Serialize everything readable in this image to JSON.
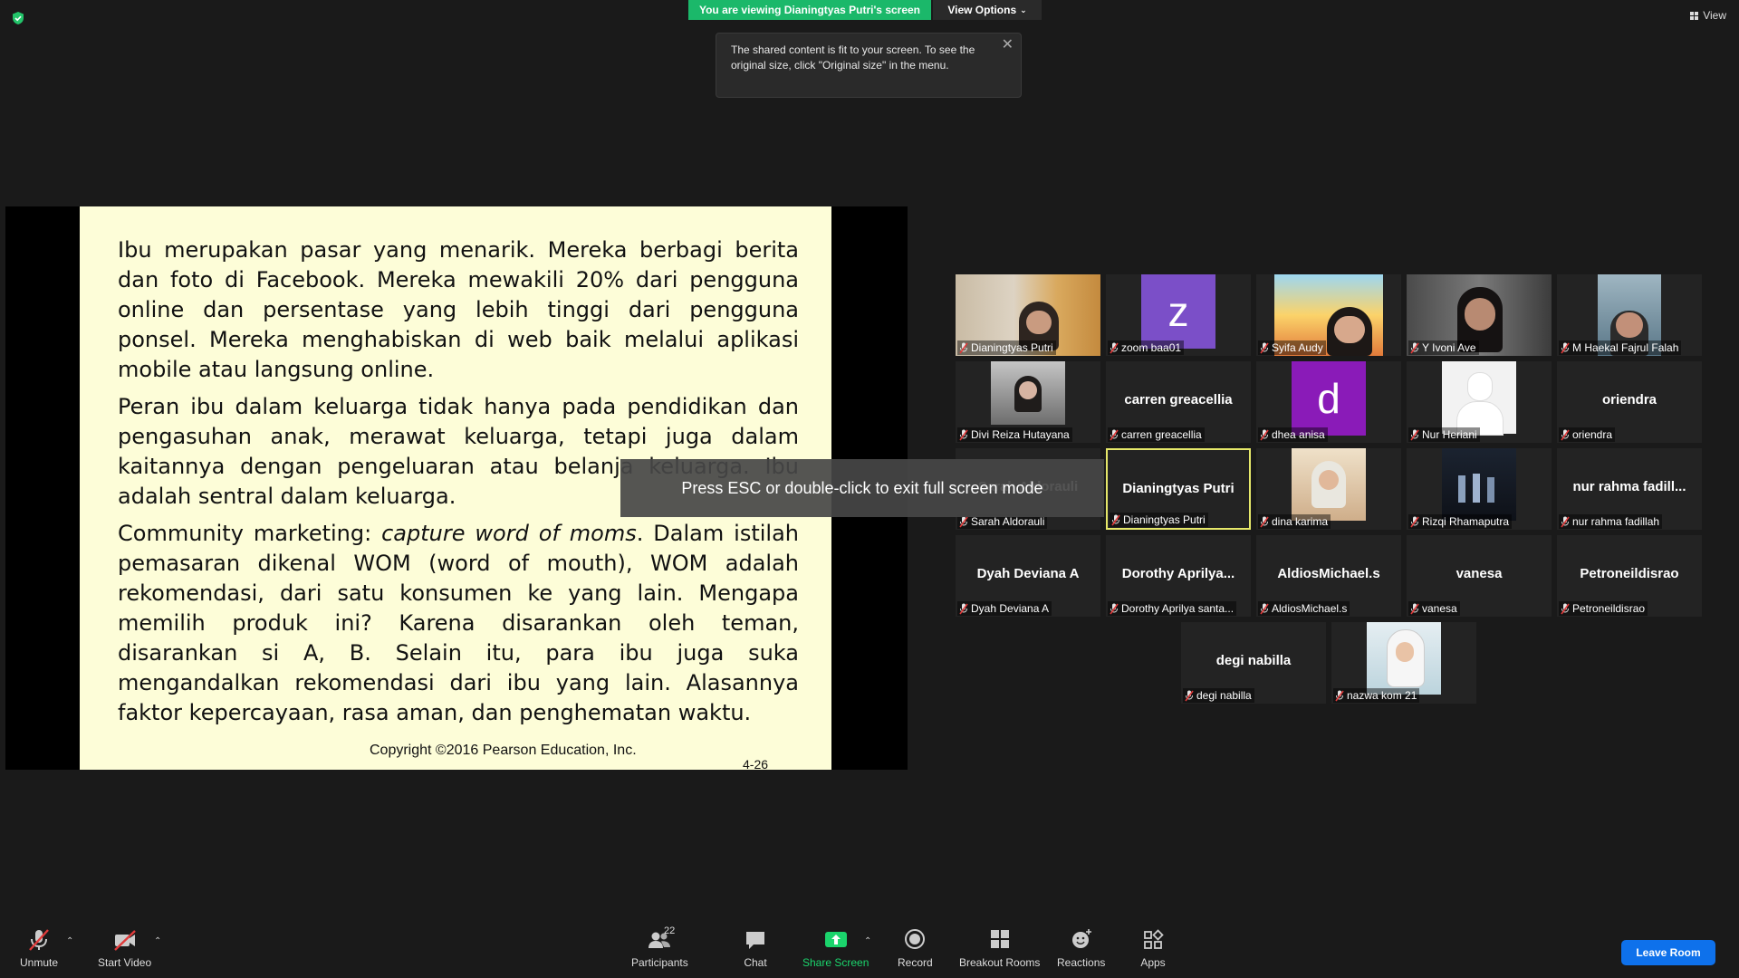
{
  "top": {
    "banner": "You are viewing Dianingtyas Putri's screen",
    "view_options": "View Options",
    "tooltip": "The shared content is fit to your screen. To see the original size, click \"Original size\" in the menu.",
    "view": "View"
  },
  "slide": {
    "p1": "Ibu merupakan pasar yang menarik. Mereka berbagi berita dan foto di Facebook. Mereka mewakili 20% dari pengguna online dan persentase yang lebih tinggi dari pengguna ponsel. Mereka menghabiskan di web baik melalui aplikasi mobile atau langsung online.",
    "p2": "Peran ibu dalam keluarga tidak hanya pada pendidikan dan pengasuhan anak, merawat keluarga, tetapi juga dalam kaitannya dengan pengeluaran atau belanja keluarga. Ibu adalah sentral dalam keluarga.",
    "p3_start": "Community marketing: ",
    "p3_italic": "capture word of moms",
    "p3_rest": ". Dalam istilah pemasaran dikenal WOM (word of mouth), WOM adalah rekomendasi, dari satu konsumen ke yang lain. Mengapa memilih produk ini? Karena disarankan oleh teman, disarankan si A, B. Selain itu, para ibu juga suka mengandalkan rekomendasi dari ibu yang lain. Alasannya faktor kepercayaan, rasa aman, dan penghematan waktu.",
    "copyright": "Copyright ©2016 Pearson Education, Inc.",
    "page": "4-26"
  },
  "overlay": {
    "esc_text": "Press ESC or double-click to exit full screen mode"
  },
  "participants": [
    {
      "label": "Dianingtyas Putri"
    },
    {
      "label": "zoom baa01",
      "avatar": "z",
      "avatar_color": "#7b4fc8"
    },
    {
      "label": "Syifa Audy"
    },
    {
      "label": "Y Ivoni Ave"
    },
    {
      "label": "M Haekal Fajrul Falah"
    },
    {
      "label": "Divi Reiza Hutayana"
    },
    {
      "label": "carren greacellia",
      "center": "carren greacellia"
    },
    {
      "label": "dhea anisa",
      "avatar": "d",
      "avatar_color": "#8a1bb8"
    },
    {
      "label": "Nur Heriani"
    },
    {
      "label": "oriendra",
      "center": "oriendra"
    },
    {
      "label": "Sarah Aldorauli",
      "center": "Sarah Aldorauli"
    },
    {
      "label": "Dianingtyas Putri",
      "center": "Dianingtyas Putri"
    },
    {
      "label": "dina karima"
    },
    {
      "label": "Rizqi Rhamaputra"
    },
    {
      "label": "nur rahma fadillah",
      "center": "nur rahma fadill..."
    },
    {
      "label": "Dyah Deviana A",
      "center": "Dyah Deviana A"
    },
    {
      "label": "Dorothy Aprilya santa...",
      "center": "Dorothy Aprilya..."
    },
    {
      "label": "AldiosMichael.s",
      "center": "AldiosMichael.s"
    },
    {
      "label": "vanesa",
      "center": "vanesa"
    },
    {
      "label": "Petroneildisrao",
      "center": "Petroneildisrao"
    },
    {
      "label": "degi nabilla",
      "center": "degi nabilla"
    },
    {
      "label": "nazwa kom 21"
    }
  ],
  "toolbar": {
    "unmute": "Unmute",
    "start_video": "Start Video",
    "participants": "Participants",
    "participants_count": "22",
    "chat": "Chat",
    "share_screen": "Share Screen",
    "record": "Record",
    "breakout": "Breakout Rooms",
    "reactions": "Reactions",
    "apps": "Apps",
    "leave": "Leave Room"
  },
  "colors": {
    "banner": "#1bb86a",
    "leave": "#0e71eb",
    "active_speaker": "#e6e86a",
    "slide_bg": "#fdfdd8"
  }
}
